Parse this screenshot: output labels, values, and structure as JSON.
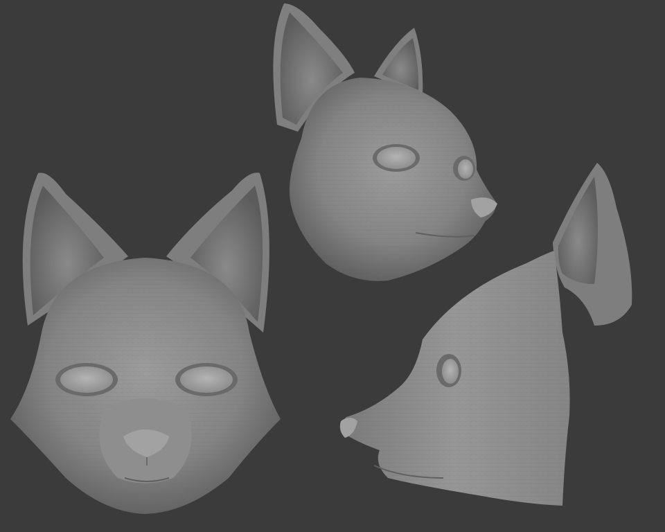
{
  "scene": {
    "background_color": "#3b3b3c",
    "material_color": "#8e8e8e",
    "views": [
      {
        "id": "front",
        "name": "front-view"
      },
      {
        "id": "three-quarter",
        "name": "three-quarter-view"
      },
      {
        "id": "side",
        "name": "side-profile-view"
      }
    ]
  }
}
